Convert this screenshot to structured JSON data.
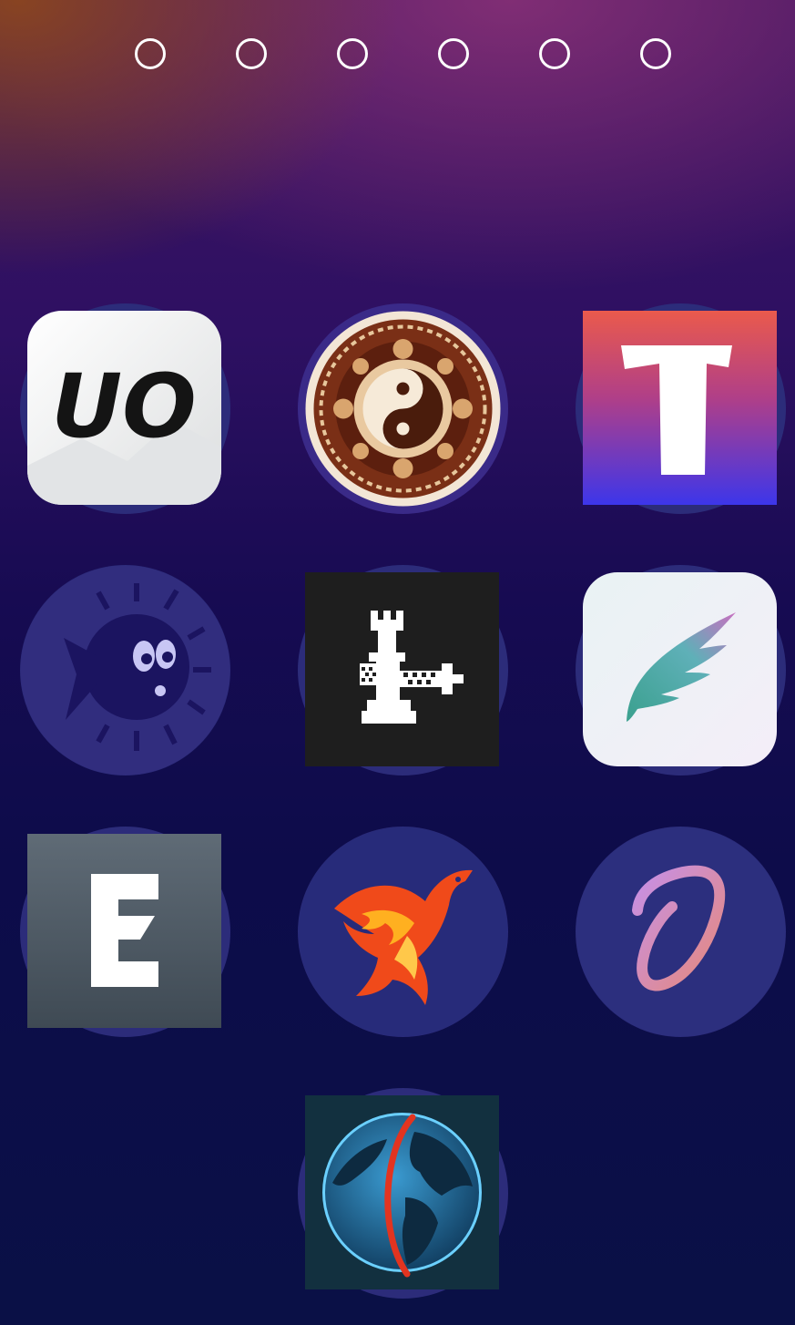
{
  "page_indicator": {
    "count": 6,
    "dots": [
      "page-1",
      "page-2",
      "page-3",
      "page-4",
      "page-5",
      "page-6"
    ]
  },
  "apps": [
    {
      "id": "unc0ver",
      "icon": "unc0ver-icon",
      "glyph_text": "UO",
      "colors": [
        "#f2f2f2",
        "#111111"
      ]
    },
    {
      "id": "taichi",
      "icon": "yin-yang-icon",
      "colors": [
        "#6b3018",
        "#e9c9a0"
      ]
    },
    {
      "id": "taurine",
      "icon": "letter-t-icon",
      "glyph_text": "T",
      "colors": [
        "#e8584e",
        "#4433e8"
      ]
    },
    {
      "id": "blowfish",
      "icon": "pufferfish-icon",
      "colors": [
        "#1a1460"
      ]
    },
    {
      "id": "checkra1n",
      "icon": "chess-pieces-icon",
      "colors": [
        "#1e1e1e",
        "#ffffff"
      ]
    },
    {
      "id": "sileo-wing",
      "icon": "wing-icon",
      "colors": [
        "#eef2f8",
        "#4fb09a"
      ]
    },
    {
      "id": "electra",
      "icon": "letter-e-icon",
      "glyph_text": "E",
      "colors": [
        "#5a6670",
        "#ffffff"
      ]
    },
    {
      "id": "phoenix",
      "icon": "phoenix-icon",
      "colors": [
        "#f04a1a",
        "#ffb020"
      ]
    },
    {
      "id": "odyssey",
      "icon": "letter-o-script-icon",
      "colors": [
        "#c690e8",
        "#e08a80"
      ]
    },
    {
      "id": "chimera-globe",
      "icon": "globe-icon",
      "colors": [
        "#12303f",
        "#2a7fb0",
        "#e23420"
      ]
    }
  ]
}
